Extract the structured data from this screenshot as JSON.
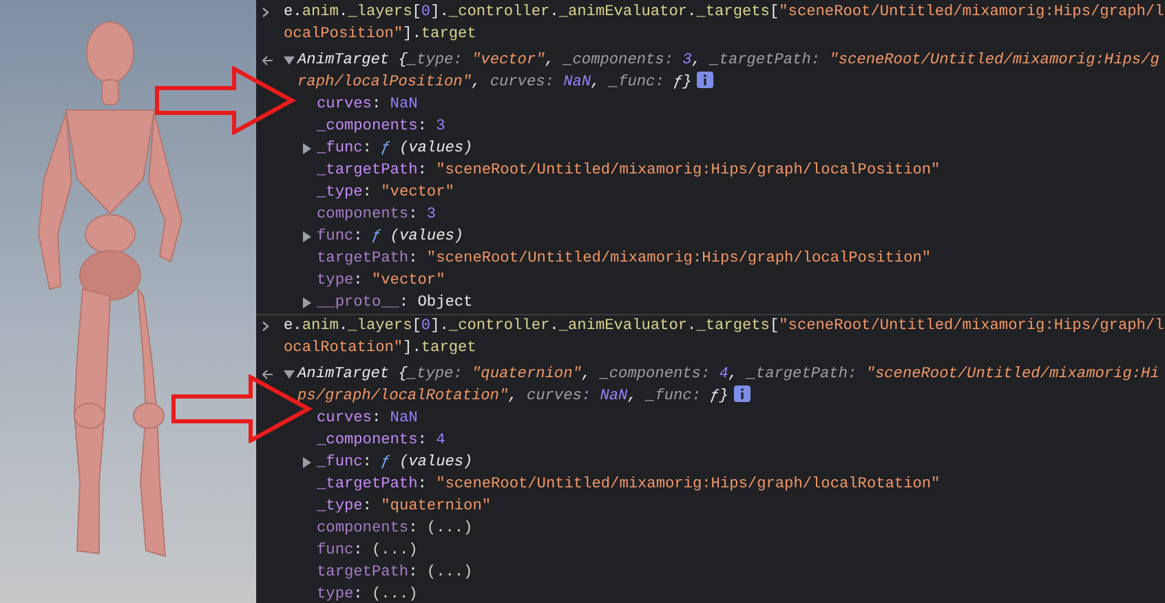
{
  "console": {
    "entries": [
      {
        "command": [
          {
            "text": "e.",
            "kind": "plain"
          },
          {
            "text": "anim",
            "kind": "prop"
          },
          {
            "text": ".",
            "kind": "plain"
          },
          {
            "text": "_layers",
            "kind": "prop"
          },
          {
            "text": "[",
            "kind": "plain"
          },
          {
            "text": "0",
            "kind": "number"
          },
          {
            "text": "].",
            "kind": "plain"
          },
          {
            "text": "_controller",
            "kind": "prop"
          },
          {
            "text": ".",
            "kind": "plain"
          },
          {
            "text": "_animEvaluator",
            "kind": "prop"
          },
          {
            "text": ".",
            "kind": "plain"
          },
          {
            "text": "_targets",
            "kind": "prop"
          },
          {
            "text": "[",
            "kind": "plain"
          },
          {
            "text": "\"sceneRoot/Untitled/mixamorig:Hips/graph/localPosition\"",
            "kind": "string"
          },
          {
            "text": "].",
            "kind": "plain"
          },
          {
            "text": "target",
            "kind": "prop"
          }
        ],
        "result": {
          "expanded": true,
          "summary": [
            {
              "text": "AnimTarget {",
              "kind": "plain"
            },
            {
              "text": "_type: ",
              "kind": "key"
            },
            {
              "text": "\"vector\"",
              "kind": "string"
            },
            {
              "text": ", ",
              "kind": "plain"
            },
            {
              "text": "_components: ",
              "kind": "key"
            },
            {
              "text": "3",
              "kind": "number"
            },
            {
              "text": ", ",
              "kind": "plain"
            },
            {
              "text": "_targetPath: ",
              "kind": "key"
            },
            {
              "text": "\"sceneRoot/Untitled/mixamorig:Hips/graph/localPosition\"",
              "kind": "string"
            },
            {
              "text": ", ",
              "kind": "plain"
            },
            {
              "text": "curves: ",
              "kind": "key"
            },
            {
              "text": "NaN",
              "kind": "number"
            },
            {
              "text": ", ",
              "kind": "plain"
            },
            {
              "text": "_func: ",
              "kind": "key"
            },
            {
              "text": "ƒ}",
              "kind": "plain"
            }
          ],
          "properties": [
            {
              "text": "curves: NaN",
              "kind": "number",
              "expandable": false,
              "accessor": false
            },
            {
              "text": "_components: 3",
              "kind": "number",
              "expandable": false,
              "accessor": false
            },
            {
              "text": "_func: ƒ (values)",
              "kind": "function",
              "expandable": true,
              "accessor": false
            },
            {
              "text": "_targetPath: \"sceneRoot/Untitled/mixamorig:Hips/graph/localPosition\"",
              "kind": "string",
              "expandable": false,
              "accessor": false
            },
            {
              "text": "_type: \"vector\"",
              "kind": "string",
              "expandable": false,
              "accessor": false
            },
            {
              "text": "components: 3",
              "kind": "number",
              "expandable": false,
              "accessor": true
            },
            {
              "text": "func: ƒ (values)",
              "kind": "function",
              "expandable": true,
              "accessor": true
            },
            {
              "text": "targetPath: \"sceneRoot/Untitled/mixamorig:Hips/graph/localPosition\"",
              "kind": "string",
              "expandable": false,
              "accessor": true
            },
            {
              "text": "type: \"vector\"",
              "kind": "string",
              "expandable": false,
              "accessor": true
            },
            {
              "text": "__proto__: Object",
              "kind": "object",
              "expandable": true,
              "accessor": true
            }
          ]
        }
      },
      {
        "command": [
          {
            "text": "e.",
            "kind": "plain"
          },
          {
            "text": "anim",
            "kind": "prop"
          },
          {
            "text": ".",
            "kind": "plain"
          },
          {
            "text": "_layers",
            "kind": "prop"
          },
          {
            "text": "[",
            "kind": "plain"
          },
          {
            "text": "0",
            "kind": "number"
          },
          {
            "text": "].",
            "kind": "plain"
          },
          {
            "text": "_controller",
            "kind": "prop"
          },
          {
            "text": ".",
            "kind": "plain"
          },
          {
            "text": "_animEvaluator",
            "kind": "prop"
          },
          {
            "text": ".",
            "kind": "plain"
          },
          {
            "text": "_targets",
            "kind": "prop"
          },
          {
            "text": "[",
            "kind": "plain"
          },
          {
            "text": "\"sceneRoot/Untitled/mixamorig:Hips/graph/localRotation\"",
            "kind": "string"
          },
          {
            "text": "].",
            "kind": "plain"
          },
          {
            "text": "target",
            "kind": "prop"
          }
        ],
        "result": {
          "expanded": true,
          "summary": [
            {
              "text": "AnimTarget {",
              "kind": "plain"
            },
            {
              "text": "_type: ",
              "kind": "key"
            },
            {
              "text": "\"quaternion\"",
              "kind": "string"
            },
            {
              "text": ", ",
              "kind": "plain"
            },
            {
              "text": "_components: ",
              "kind": "key"
            },
            {
              "text": "4",
              "kind": "number"
            },
            {
              "text": ", ",
              "kind": "plain"
            },
            {
              "text": "_targetPath: ",
              "kind": "key"
            },
            {
              "text": "\"sceneRoot/Untitled/mixamorig:Hips/graph/localRotation\"",
              "kind": "string"
            },
            {
              "text": ", ",
              "kind": "plain"
            },
            {
              "text": "curves: ",
              "kind": "key"
            },
            {
              "text": "NaN",
              "kind": "number"
            },
            {
              "text": ", ",
              "kind": "plain"
            },
            {
              "text": "_func: ",
              "kind": "key"
            },
            {
              "text": "ƒ}",
              "kind": "plain"
            }
          ],
          "properties": [
            {
              "text": "curves: NaN",
              "kind": "number",
              "expandable": false,
              "accessor": false
            },
            {
              "text": "_components: 4",
              "kind": "number",
              "expandable": false,
              "accessor": false
            },
            {
              "text": "_func: ƒ (values)",
              "kind": "function",
              "expandable": true,
              "accessor": false
            },
            {
              "text": "_targetPath: \"sceneRoot/Untitled/mixamorig:Hips/graph/localRotation\"",
              "kind": "string",
              "expandable": false,
              "accessor": false
            },
            {
              "text": "_type: \"quaternion\"",
              "kind": "string",
              "expandable": false,
              "accessor": false
            },
            {
              "text": "components: (...)",
              "kind": "lazy",
              "expandable": false,
              "accessor": true
            },
            {
              "text": "func: (...)",
              "kind": "lazy",
              "expandable": false,
              "accessor": true
            },
            {
              "text": "targetPath: (...)",
              "kind": "lazy",
              "expandable": false,
              "accessor": true
            },
            {
              "text": "type: (...)",
              "kind": "lazy",
              "expandable": false,
              "accessor": true
            }
          ]
        }
      }
    ]
  },
  "annotations": [
    {
      "kind": "arrow"
    },
    {
      "kind": "arrow"
    }
  ]
}
